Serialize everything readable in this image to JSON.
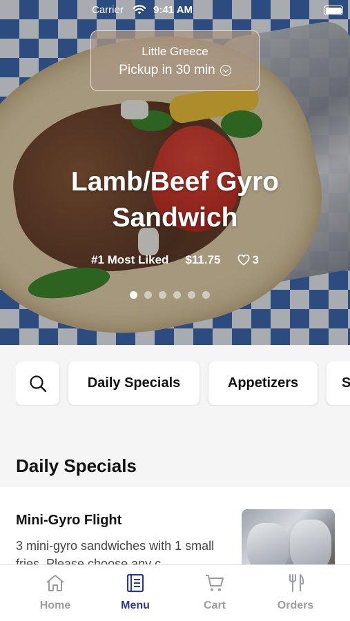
{
  "status_bar": {
    "carrier": "Carrier",
    "time": "9:41 AM"
  },
  "location": {
    "name": "Little Greece",
    "pickup": "Pickup in 30 min"
  },
  "featured_item": {
    "title_line1": "Lamb/Beef Gyro",
    "title_line2": "Sandwich",
    "badge": "#1 Most Liked",
    "price": "$11.75",
    "likes": "3",
    "carousel_pages": 6,
    "carousel_active": 1
  },
  "categories": [
    "Daily Specials",
    "Appetizers",
    "S"
  ],
  "section": {
    "title": "Daily Specials"
  },
  "menu_items": [
    {
      "name": "Mini-Gyro Flight",
      "description": "3 mini-gyro sandwiches with 1 small fries. Please choose any c..."
    }
  ],
  "tabs": [
    {
      "label": "Home",
      "icon": "home-icon",
      "active": false
    },
    {
      "label": "Menu",
      "icon": "menu-book-icon",
      "active": true
    },
    {
      "label": "Cart",
      "icon": "cart-icon",
      "active": false
    },
    {
      "label": "Orders",
      "icon": "fork-knife-icon",
      "active": false
    }
  ],
  "colors": {
    "accent": "#2b3a8f",
    "inactive_tab": "#9a9ca2",
    "background": "#f5f5f6"
  }
}
